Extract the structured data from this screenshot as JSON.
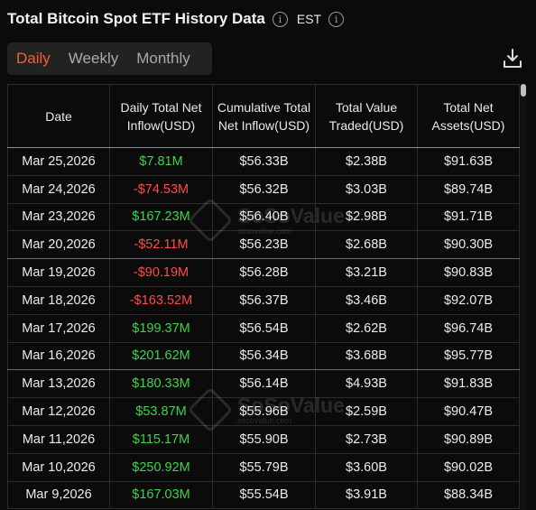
{
  "header": {
    "title": "Total Bitcoin Spot ETF History Data",
    "timezone": "EST"
  },
  "tabs": [
    "Daily",
    "Weekly",
    "Monthly"
  ],
  "active_tab": "Daily",
  "table": {
    "columns": [
      "Date",
      "Daily Total Net Inflow(USD)",
      "Cumulative Total Net Inflow(USD)",
      "Total Value Traded(USD)",
      "Total Net Assets(USD)"
    ],
    "rows": [
      [
        "Mar 25,2026",
        "$7.81M",
        "$56.33B",
        "$2.38B",
        "$91.63B"
      ],
      [
        "Mar 24,2026",
        "-$74.53M",
        "$56.32B",
        "$3.03B",
        "$89.74B"
      ],
      [
        "Mar 23,2026",
        "$167.23M",
        "$56.40B",
        "$2.98B",
        "$91.71B"
      ],
      [
        "Mar 20,2026",
        "-$52.11M",
        "$56.23B",
        "$2.68B",
        "$90.30B"
      ],
      [
        "Mar 19,2026",
        "-$90.19M",
        "$56.28B",
        "$3.21B",
        "$90.83B"
      ],
      [
        "Mar 18,2026",
        "-$163.52M",
        "$56.37B",
        "$3.46B",
        "$92.07B"
      ],
      [
        "Mar 17,2026",
        "$199.37M",
        "$56.54B",
        "$2.62B",
        "$96.74B"
      ],
      [
        "Mar 16,2026",
        "$201.62M",
        "$56.34B",
        "$3.68B",
        "$95.77B"
      ],
      [
        "Mar 13,2026",
        "$180.33M",
        "$56.14B",
        "$4.93B",
        "$91.83B"
      ],
      [
        "Mar 12,2026",
        "$53.87M",
        "$55.96B",
        "$2.59B",
        "$90.47B"
      ],
      [
        "Mar 11,2026",
        "$115.17M",
        "$55.90B",
        "$2.73B",
        "$90.89B"
      ],
      [
        "Mar 10,2026",
        "$250.92M",
        "$55.79B",
        "$3.60B",
        "$90.02B"
      ],
      [
        "Mar 9,2026",
        "$167.03M",
        "$55.54B",
        "$3.91B",
        "$88.34B"
      ]
    ]
  },
  "watermark": {
    "name": "SoSoValue",
    "url": "sosovalue.com"
  },
  "colors": {
    "positive": "#3fd34b",
    "negative": "#ff4b4b",
    "accent": "#ff5a2e"
  }
}
